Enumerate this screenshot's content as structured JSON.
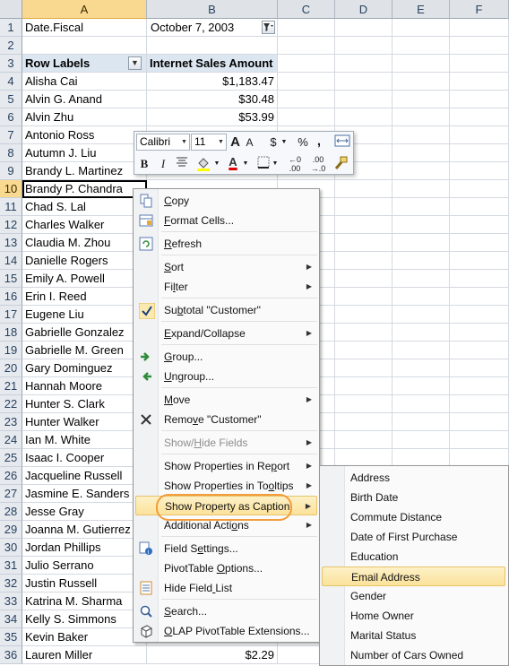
{
  "columns": [
    "A",
    "B",
    "C",
    "D",
    "E",
    "F"
  ],
  "rows": [
    "1",
    "2",
    "3",
    "4",
    "5",
    "6",
    "7",
    "8",
    "9",
    "10",
    "11",
    "12",
    "13",
    "14",
    "15",
    "16",
    "17",
    "18",
    "19",
    "20",
    "21",
    "22",
    "23",
    "24",
    "25",
    "26",
    "27",
    "28",
    "29",
    "30",
    "31",
    "32",
    "33",
    "34",
    "35",
    "36"
  ],
  "sheet": {
    "filter_label": "Date.Fiscal",
    "filter_value": "October 7, 2003",
    "row_labels_header": "Row Labels",
    "value_header": "Internet Sales Amount",
    "customers": [
      "Alisha Cai",
      "Alvin G. Anand",
      "Alvin Zhu",
      "Antonio Ross",
      "Autumn J. Liu",
      "Brandy L. Martinez",
      "Brandy P. Chandra",
      "Chad S. Lal",
      "Charles Walker",
      "Claudia M. Zhou",
      "Danielle Rogers",
      "Emily A. Powell",
      "Erin I. Reed",
      "Eugene Liu",
      "Gabrielle Gonzalez",
      "Gabrielle M. Green",
      "Gary Dominguez",
      "Hannah Moore",
      "Hunter S. Clark",
      "Hunter Walker",
      "Ian M. White",
      "Isaac I. Cooper",
      "Jacqueline Russell",
      "Jasmine E. Sanders",
      "Jesse Gray",
      "Joanna M. Gutierrez",
      "Jordan Phillips",
      "Julio Serrano",
      "Justin Russell",
      "Katrina M. Sharma",
      "Kelly S. Simmons",
      "Kevin Baker",
      "Lauren Miller"
    ],
    "amounts": [
      "$1,183.47",
      "$30.48",
      "$53.99",
      "",
      "",
      "",
      "",
      "",
      "",
      "",
      "",
      "",
      "",
      "",
      "",
      "",
      "",
      "",
      "",
      "",
      "",
      "",
      "",
      "",
      "",
      "",
      "",
      "",
      "",
      "",
      "",
      "",
      "$2.29"
    ]
  },
  "mini_toolbar": {
    "font_name": "Calibri",
    "font_size": "11",
    "grow_font": "A",
    "shrink_font": "A",
    "currency": "$",
    "percent": "%",
    "comma": ",",
    "bold": "B",
    "italic": "I",
    "font_color": "A"
  },
  "context_menu": {
    "items": [
      {
        "label": "Copy",
        "icon": "copy-icon"
      },
      {
        "label": "Format Cells...",
        "icon": "format-cells-icon"
      },
      {
        "label": "Refresh",
        "icon": "refresh-icon"
      },
      {
        "label": "Sort"
      },
      {
        "label": "Filter"
      },
      {
        "label": "Subtotal \"Customer\"",
        "icon": "checkmark-icon"
      },
      {
        "label": "Expand/Collapse"
      },
      {
        "label": "Group...",
        "icon": "group-arrow-icon"
      },
      {
        "label": "Ungroup...",
        "icon": "ungroup-arrow-icon"
      },
      {
        "label": "Move"
      },
      {
        "label": "Remove \"Customer\"",
        "icon": "remove-x-icon"
      },
      {
        "label": "Show/Hide Fields"
      },
      {
        "label": "Show Properties in Report"
      },
      {
        "label": "Show Properties in Tooltips"
      },
      {
        "label": "Show Property as Caption"
      },
      {
        "label": "Additional Actions"
      },
      {
        "label": "Field Settings...",
        "icon": "field-settings-icon"
      },
      {
        "label": "PivotTable Options..."
      },
      {
        "label": "Hide Field List",
        "icon": "field-list-icon"
      },
      {
        "label": "Search...",
        "icon": "search-icon"
      },
      {
        "label": "OLAP PivotTable Extensions...",
        "icon": "cube-icon"
      }
    ]
  },
  "submenu": {
    "items": [
      "Address",
      "Birth Date",
      "Commute Distance",
      "Date of First Purchase",
      "Education",
      "Email Address",
      "Gender",
      "Home Owner",
      "Marital Status",
      "Number of Cars Owned"
    ]
  },
  "colors": {
    "selection": "#f9d98f",
    "highlight": "#fbe29a",
    "callout_ring": "#f29c3c",
    "pivot_header": "#dce6f1"
  }
}
